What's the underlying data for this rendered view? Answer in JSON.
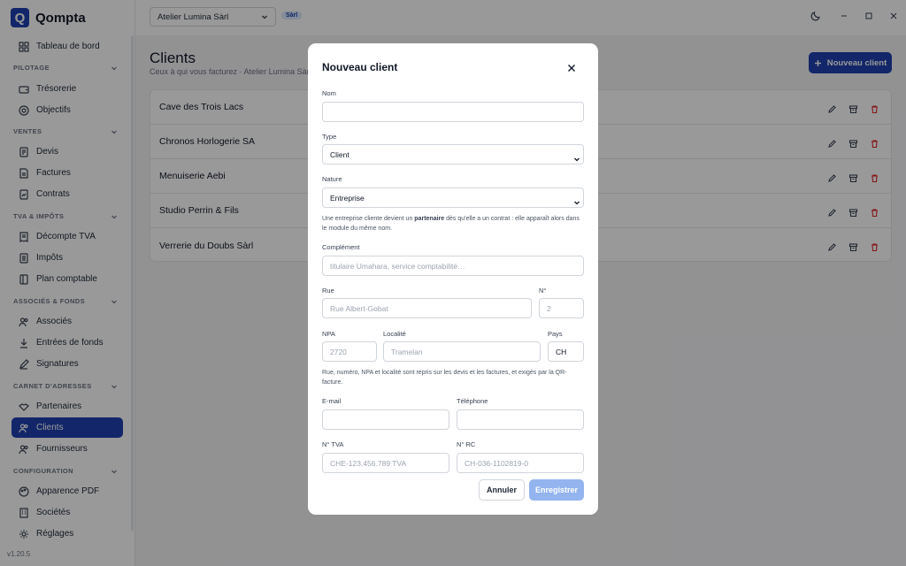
{
  "app": {
    "logo_letter": "Q",
    "name": "Qompta",
    "version": "v1.20.5",
    "accent": "#1e40af"
  },
  "header": {
    "company": "Atelier Lumina Sàrl",
    "company_badge": "Sàrl"
  },
  "sidebar": {
    "dashboard": "Tableau de bord",
    "sections": {
      "pilotage": "PILOTAGE",
      "ventes": "VENTES",
      "tva": "TVA & IMPÔTS",
      "associes": "ASSOCIÉS & FONDS",
      "carnet": "CARNET D'ADRESSES",
      "configuration": "CONFIGURATION"
    },
    "items": {
      "tresorerie": "Trésorerie",
      "objectifs": "Objectifs",
      "devis": "Devis",
      "factures": "Factures",
      "contrats": "Contrats",
      "decompte_tva": "Décompte TVA",
      "impots": "Impôts",
      "plan_comptable": "Plan comptable",
      "associes": "Associés",
      "entrees_fonds": "Entrées de fonds",
      "signatures": "Signatures",
      "partenaires": "Partenaires",
      "clients": "Clients",
      "fournisseurs": "Fournisseurs",
      "apparence_pdf": "Apparence PDF",
      "societes": "Sociétés",
      "reglages": "Réglages"
    }
  },
  "page": {
    "title": "Clients",
    "subtitle": "Ceux à qui vous facturez · Atelier Lumina Sàrl",
    "new_button": "Nouveau client"
  },
  "clients": [
    "Cave des Trois Lacs",
    "Chronos Horlogerie SA",
    "Menuiserie Aebi",
    "Studio Perrin & Fils",
    "Verrerie du Doubs Sàrl"
  ],
  "modal": {
    "title": "Nouveau client",
    "nom_label": "Nom",
    "nom_value": "",
    "type_label": "Type",
    "type_value": "Client",
    "nature_label": "Nature",
    "nature_value": "Entreprise",
    "nature_hint_pre": "Une entreprise cliente devient un ",
    "nature_hint_bold": "partenaire",
    "nature_hint_post": " dès qu'elle a un contrat : elle apparaît alors dans le module du même nom.",
    "complement_label": "Complément",
    "complement_placeholder": "titulaire Umahara, service comptabilité…",
    "rue_label": "Rue",
    "rue_placeholder": "Rue Albert-Gobat",
    "numero_label": "N°",
    "numero_placeholder": "2",
    "npa_label": "NPA",
    "npa_placeholder": "2720",
    "localite_label": "Localité",
    "localite_placeholder": "Tramelan",
    "pays_label": "Pays",
    "pays_value": "CH",
    "address_hint": "Rue, numéro, NPA et localité sont repris sur les devis et les factures, et exigés par la QR-facture.",
    "email_label": "E-mail",
    "telephone_label": "Téléphone",
    "tva_label": "N° TVA",
    "tva_placeholder": "CHE-123.456.789 TVA",
    "rc_label": "N° RC",
    "rc_placeholder": "CH-036-1102819-0",
    "cancel": "Annuler",
    "save": "Enregistrer"
  }
}
